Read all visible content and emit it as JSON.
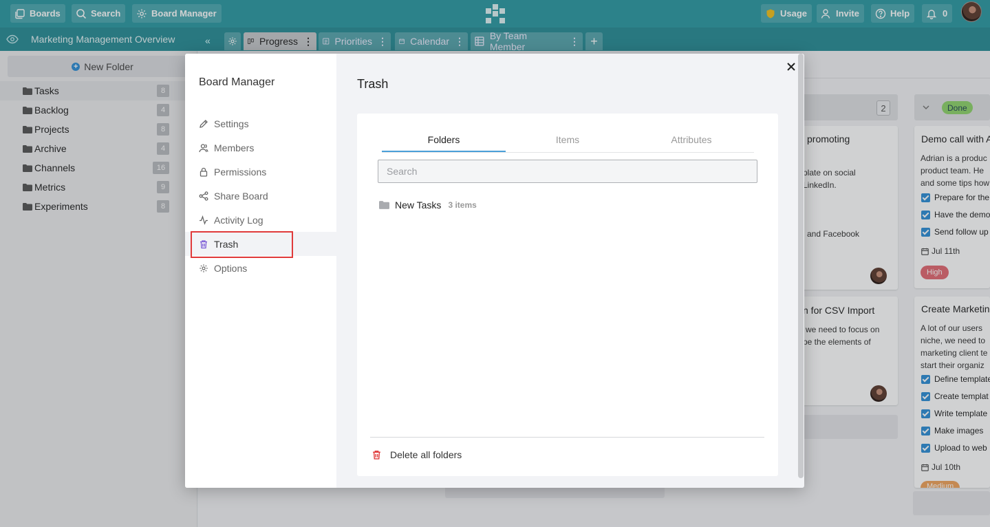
{
  "topbar": {
    "boards": "Boards",
    "search": "Search",
    "board_manager": "Board Manager",
    "usage": "Usage",
    "invite": "Invite",
    "help": "Help",
    "notifications": "0"
  },
  "board": {
    "title": "Marketing Management Overview"
  },
  "views": [
    {
      "label": "Progress"
    },
    {
      "label": "Priorities"
    },
    {
      "label": "Calendar"
    },
    {
      "label": "By Team Member"
    }
  ],
  "sidebar": {
    "new_folder": "New Folder",
    "folders": [
      {
        "name": "Tasks",
        "count": "8"
      },
      {
        "name": "Backlog",
        "count": "4"
      },
      {
        "name": "Projects",
        "count": "8"
      },
      {
        "name": "Archive",
        "count": "4"
      },
      {
        "name": "Channels",
        "count": "16"
      },
      {
        "name": "Metrics",
        "count": "9"
      },
      {
        "name": "Experiments",
        "count": "8"
      }
    ]
  },
  "background": {
    "column_count": "2",
    "done_label": "Done",
    "card1": {
      "title_fragment": "promoting",
      "line1": "plate on social",
      "line2": "LinkedIn.",
      "line3": "and Facebook"
    },
    "card2": {
      "title_fragment": "n for CSV Import",
      "line1": "we need to focus on",
      "line2": "pe the elements of"
    },
    "card3": {
      "title": "Demo call with A",
      "lines": [
        "Adrian is a produc",
        "product team. He",
        "and some tips how"
      ],
      "checks": [
        "Prepare for the",
        "Have the demo",
        "Send follow up"
      ],
      "date": "Jul 11th",
      "tag": "High"
    },
    "card4": {
      "title": "Create Marketin",
      "lines": [
        "A lot of our users",
        "niche, we need to",
        "marketing client te",
        "start their organiz"
      ],
      "checks": [
        "Define template",
        "Create templat",
        "Write template",
        "Make images",
        "Upload to web"
      ],
      "date": "Jul 10th",
      "tag": "Medium"
    }
  },
  "modal": {
    "nav_title": "Board Manager",
    "nav": [
      {
        "label": "Settings",
        "icon": "pencil-icon"
      },
      {
        "label": "Members",
        "icon": "members-icon"
      },
      {
        "label": "Permissions",
        "icon": "lock-icon"
      },
      {
        "label": "Share Board",
        "icon": "share-icon"
      },
      {
        "label": "Activity Log",
        "icon": "activity-icon"
      },
      {
        "label": "Trash",
        "icon": "trash-icon"
      },
      {
        "label": "Options",
        "icon": "gear-icon"
      }
    ],
    "pane_title": "Trash",
    "tabs": [
      "Folders",
      "Items",
      "Attributes"
    ],
    "search_placeholder": "Search",
    "folder": {
      "name": "New Tasks",
      "count": "3 items"
    },
    "delete_all": "Delete all folders"
  },
  "colors": {
    "topbar": "#2d9aa3",
    "accent_blue": "#4a9fd8",
    "danger": "#e03a3a",
    "done_green": "#8fd46b"
  }
}
